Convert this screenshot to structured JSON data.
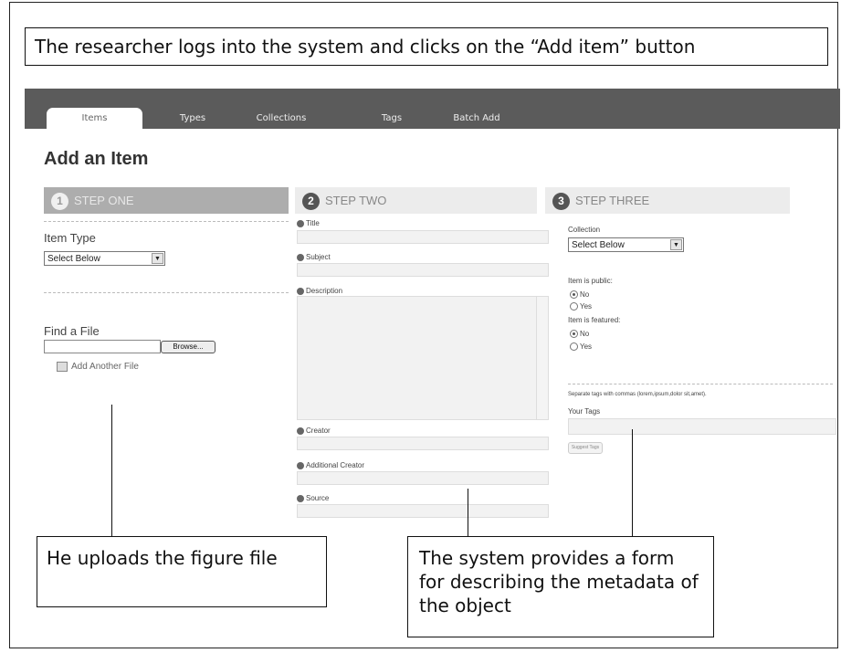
{
  "captions": {
    "top": "The researcher logs into the system and clicks on the “Add item” button",
    "left": "He uploads the figure file",
    "right": "The system provides a form for describing the metadata of the object"
  },
  "nav": {
    "tabs": [
      "Items",
      "Types",
      "Collections",
      "Tags",
      "Batch Add"
    ],
    "active": "Items"
  },
  "page": {
    "title": "Add an Item"
  },
  "steps": {
    "one": {
      "number": "1",
      "label": "STEP ONE"
    },
    "two": {
      "number": "2",
      "label": "STEP TWO"
    },
    "three": {
      "number": "3",
      "label": "STEP THREE"
    }
  },
  "step_one": {
    "item_type_label": "Item Type",
    "item_type_value": "Select Below",
    "find_file_label": "Find a File",
    "browse_label": "Browse...",
    "add_file_label": "Add Another File"
  },
  "step_two": {
    "fields": [
      "Title",
      "Subject",
      "Description",
      "Creator",
      "Additional Creator",
      "Source"
    ]
  },
  "step_three": {
    "collection_label": "Collection",
    "collection_value": "Select Below",
    "public_label": "Item is public:",
    "featured_label": "Item is featured:",
    "no_label": "No",
    "yes_label": "Yes",
    "tags_hint": "Separate tags with commas (lorem,ipsum,dolor sit,amet).",
    "your_tags_label": "Your Tags",
    "suggest_tags_label": "Suggest Tags"
  },
  "icons": {
    "select_arrow": "chevron-down-icon",
    "info": "info-icon",
    "add_file": "add-file-icon"
  }
}
